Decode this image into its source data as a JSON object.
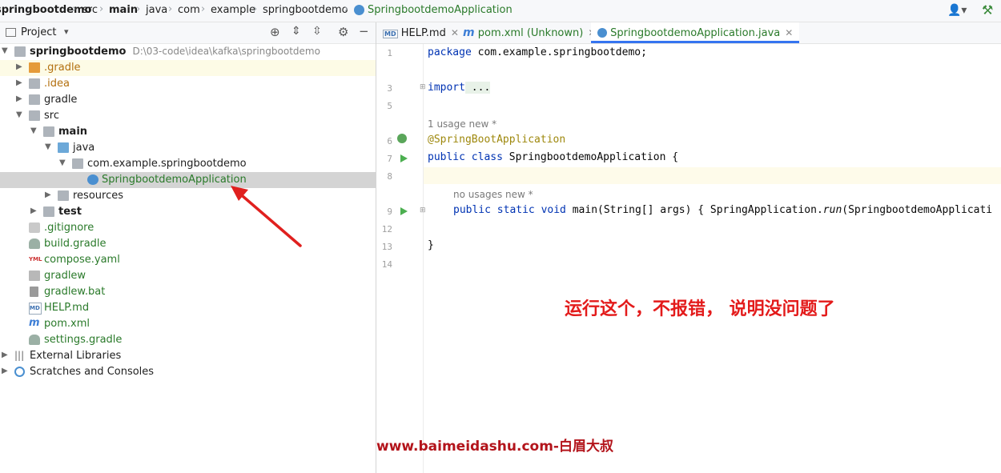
{
  "breadcrumb": {
    "items": [
      "springbootdemo",
      "src",
      "main",
      "java",
      "com",
      "example",
      "springbootdemo",
      "SpringbootdemoApplication"
    ]
  },
  "project_panel": {
    "title": "Project",
    "tree": [
      {
        "label": "springbootdemo",
        "path": "D:\\03-code\\idea\\kafka\\springbootdemo"
      },
      {
        "label": ".gradle"
      },
      {
        "label": ".idea"
      },
      {
        "label": "gradle"
      },
      {
        "label": "src"
      },
      {
        "label": "main"
      },
      {
        "label": "java"
      },
      {
        "label": "com.example.springbootdemo"
      },
      {
        "label": "SpringbootdemoApplication"
      },
      {
        "label": "resources"
      },
      {
        "label": "test"
      },
      {
        "label": ".gitignore"
      },
      {
        "label": "build.gradle"
      },
      {
        "label": "compose.yaml"
      },
      {
        "label": "gradlew"
      },
      {
        "label": "gradlew.bat"
      },
      {
        "label": "HELP.md"
      },
      {
        "label": "pom.xml"
      },
      {
        "label": "settings.gradle"
      },
      {
        "label": "External Libraries"
      },
      {
        "label": "Scratches and Consoles"
      }
    ]
  },
  "editor": {
    "tabs": [
      {
        "label": "HELP.md"
      },
      {
        "label": "pom.xml (Unknown)"
      },
      {
        "label": "SpringbootdemoApplication.java"
      }
    ],
    "line_numbers": [
      "1",
      "3",
      "5",
      "6",
      "7",
      "8",
      "9",
      "12",
      "13",
      "14"
    ],
    "code": {
      "l1_kw": "package",
      "l1_rest": " com.example.springbootdemo;",
      "l3_kw": "import",
      "l3_rest": " ...",
      "hint1": "1 usage   new *",
      "l6": "@SpringBootApplication",
      "l7_kw": "public class",
      "l7_rest": " SpringbootdemoApplication {",
      "hint2": "no usages   new *",
      "l9_kw": "public static void",
      "l9_rest": " main(String[] args) { SpringApplication.",
      "l9_run": "run",
      "l9_tail": "(SpringbootdemoApplicati",
      "l13": "}"
    }
  },
  "annotation_text": "运行这个，不报错， 说明没问题了",
  "watermark": "www.baimeidashu.com-白眉大叔",
  "colors": {
    "annotation": "#e31b1b",
    "watermark": "#b3141b",
    "accent": "#3574f0"
  }
}
